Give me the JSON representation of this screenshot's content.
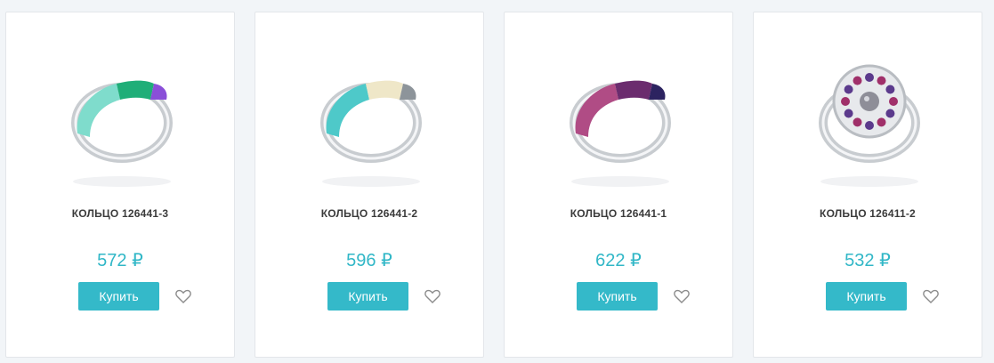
{
  "products": [
    {
      "title": "КОЛЬЦО 126441-3",
      "price": "572 ₽",
      "buy_label": "Купить",
      "image_icon": "ring-mint-purple-enamel",
      "colors": [
        "#7fdccc",
        "#1fae78",
        "#8a4fd8"
      ]
    },
    {
      "title": "КОЛЬЦО 126441-2",
      "price": "596 ₽",
      "buy_label": "Купить",
      "image_icon": "ring-grey-turquoise-enamel",
      "colors": [
        "#4ec9c9",
        "#efe7c8",
        "#8d949a"
      ]
    },
    {
      "title": "КОЛЬЦО 126441-1",
      "price": "622 ₽",
      "buy_label": "Купить",
      "image_icon": "ring-burgundy-navy-enamel",
      "colors": [
        "#b04c85",
        "#6b2c6e",
        "#2c2360"
      ]
    },
    {
      "title": "КОЛЬЦО 126411-2",
      "price": "532 ₽",
      "buy_label": "Купить",
      "image_icon": "ring-pearl-mosaic",
      "colors": [
        "#8e8e98",
        "#a0306a",
        "#5b3a8c"
      ]
    }
  ],
  "favorite_icon": "heart-outline-icon",
  "accent_color": "#34b9c9",
  "price_color": "#31b7c7"
}
